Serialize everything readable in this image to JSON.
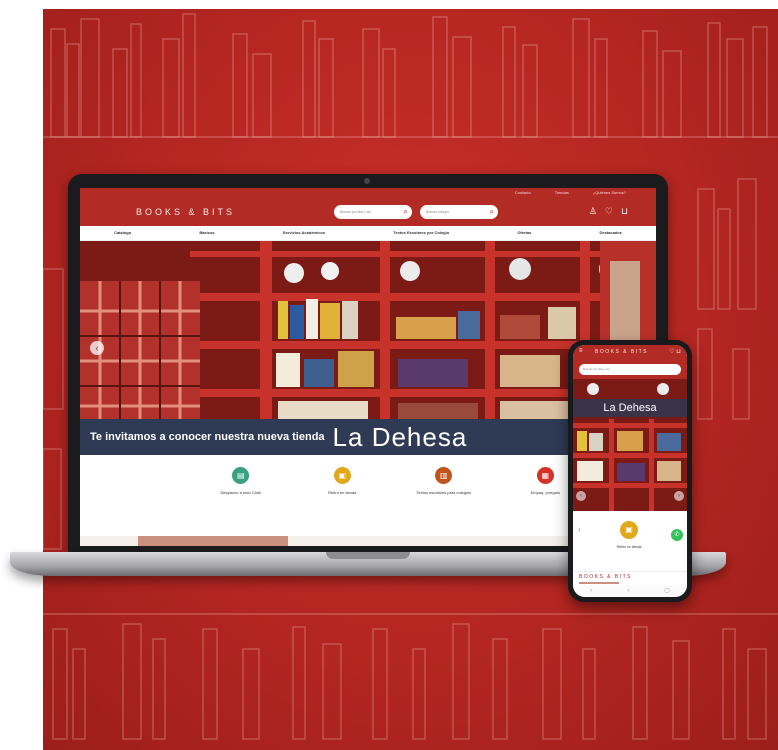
{
  "site": {
    "topbar_links": [
      "Contacto",
      "Tiendas",
      "¿Quiénes Somos?"
    ],
    "logo": "BOOKS & BITS",
    "search1_placeholder": "Buscar por libro, etc.",
    "search2_placeholder": "Buscar colegio",
    "nav": [
      "Catálogo",
      "Básicos",
      "Servicios Académicos",
      "Textos Escolares por Colegio",
      "Ofertas",
      "Destacados"
    ],
    "banner_text": "Te invitamos a conocer nuestra nueva tienda",
    "banner_big": "La Dehesa",
    "features": [
      {
        "label": "Despacho a todo Chile",
        "icon": "truck-icon",
        "color": "#3aa17e"
      },
      {
        "label": "Retiro en tienda",
        "icon": "store-icon",
        "color": "#e0a81a"
      },
      {
        "label": "Textos escolares para colegios",
        "icon": "book-icon",
        "color": "#c0541e"
      },
      {
        "label": "Empaq. p/regalo",
        "icon": "gift-icon",
        "color": "#d7322a"
      }
    ]
  },
  "phone": {
    "logo": "BOOKS & BITS",
    "search_placeholder": "Buscar por libro, etc.",
    "hero_title": "La Dehesa",
    "feature_label": "Retiro en tienda",
    "footer_logo": "BOOKS & BITS"
  },
  "colors": {
    "brand_red": "#b22b24",
    "banner_navy": "#2f3a55",
    "background_red": "#b42621"
  }
}
